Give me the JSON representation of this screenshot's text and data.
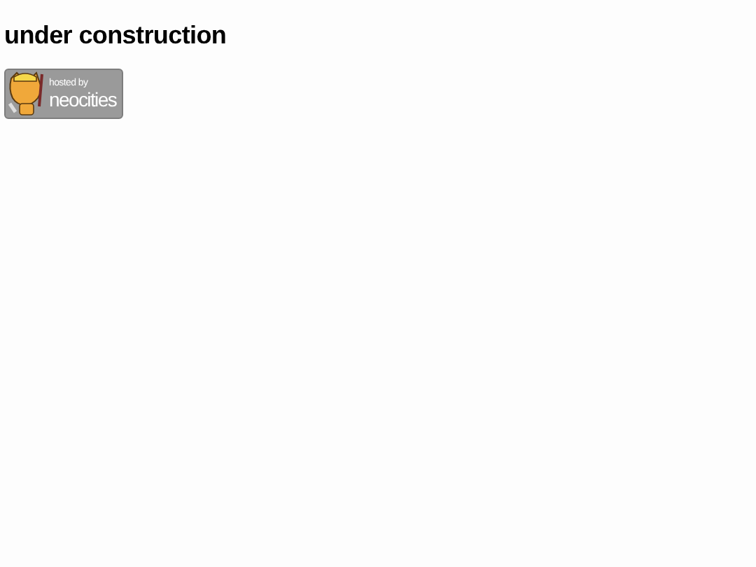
{
  "heading": "under construction",
  "badge": {
    "line_1": "hosted by",
    "line_2": "neocities"
  }
}
